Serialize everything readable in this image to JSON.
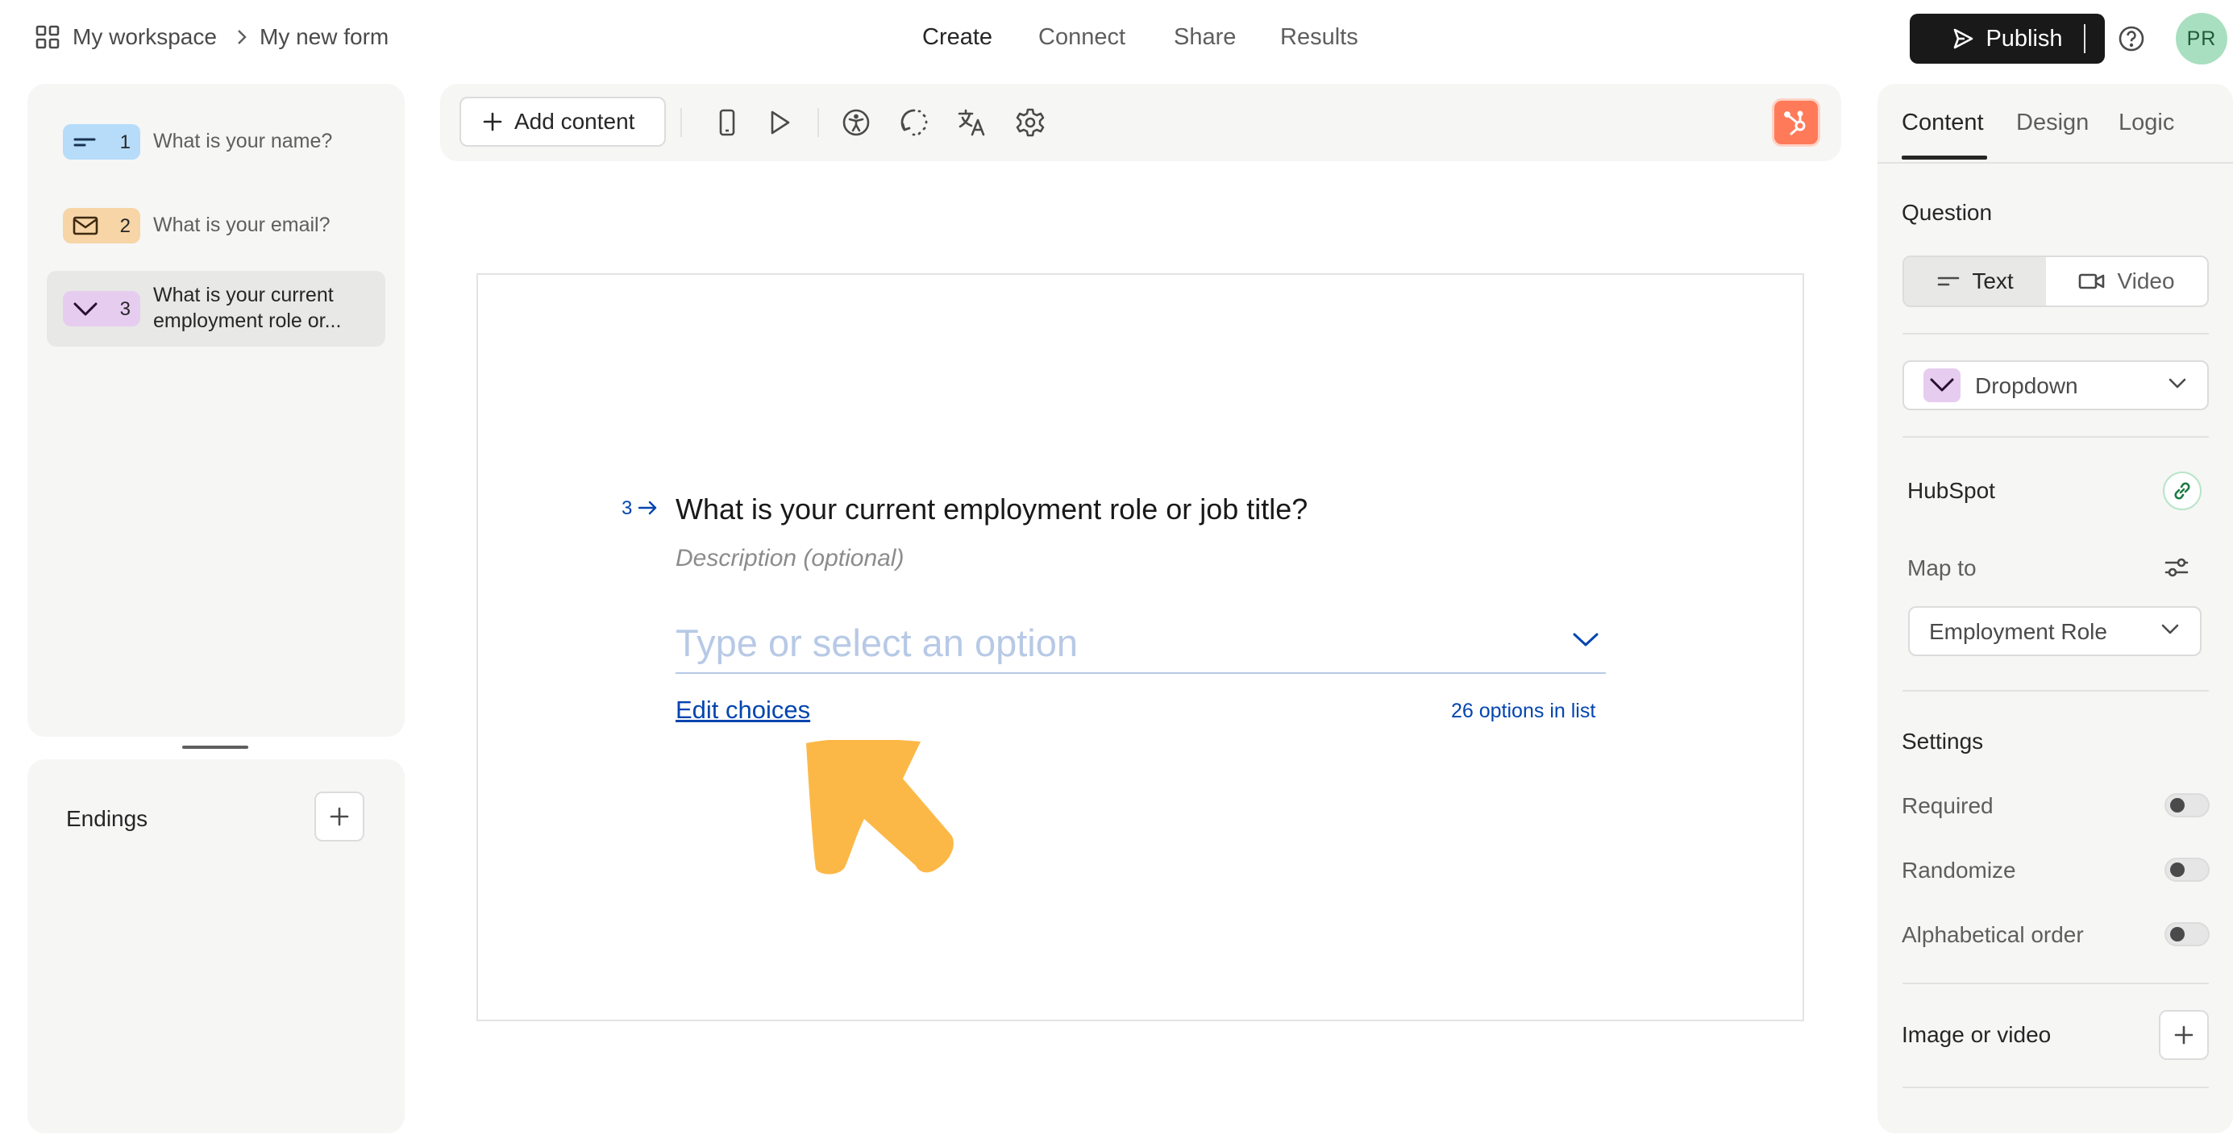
{
  "breadcrumb": {
    "workspace": "My workspace",
    "form_name": "My new form"
  },
  "nav_tabs": [
    {
      "label": "Create",
      "active": true
    },
    {
      "label": "Connect",
      "active": false
    },
    {
      "label": "Share",
      "active": false
    },
    {
      "label": "Results",
      "active": false
    }
  ],
  "header": {
    "publish_label": "Publish",
    "avatar_initials": "PR"
  },
  "questions": [
    {
      "number": "1",
      "label": "What is your name?",
      "type_icon": "short-text-icon",
      "badge_color": "#b6dcf9"
    },
    {
      "number": "2",
      "label": "What is your email?",
      "type_icon": "mail-icon",
      "badge_color": "#f7d5a6"
    },
    {
      "number": "3",
      "label_line1": "What is your current",
      "label_line2": "employment role or...",
      "type_icon": "chevron-down-icon",
      "badge_color": "#e6cdf0",
      "selected": true
    }
  ],
  "endings": {
    "title": "Endings"
  },
  "toolbar": {
    "add_content_label": "Add content"
  },
  "canvas": {
    "question_number": "3",
    "question_title": "What is your current employment role or job title?",
    "description_placeholder": "Description (optional)",
    "dropdown_placeholder": "Type or select an option",
    "edit_choices_label": "Edit choices",
    "options_count": "26 options in list",
    "annotation_color": "#fcb847"
  },
  "right_panel": {
    "tabs": [
      {
        "label": "Content",
        "active": true
      },
      {
        "label": "Design",
        "active": false
      },
      {
        "label": "Logic",
        "active": false
      }
    ],
    "question_heading": "Question",
    "question_mode": {
      "text_label": "Text",
      "video_label": "Video",
      "selected": "Text"
    },
    "question_type": "Dropdown",
    "hubspot": {
      "heading": "HubSpot",
      "map_to_label": "Map to",
      "mapped_field": "Employment Role"
    },
    "settings": {
      "heading": "Settings",
      "required": {
        "label": "Required",
        "on": false
      },
      "randomize": {
        "label": "Randomize",
        "on": false
      },
      "alphabetical": {
        "label": "Alphabetical order",
        "on": false
      }
    },
    "media": {
      "heading": "Image or video"
    }
  }
}
